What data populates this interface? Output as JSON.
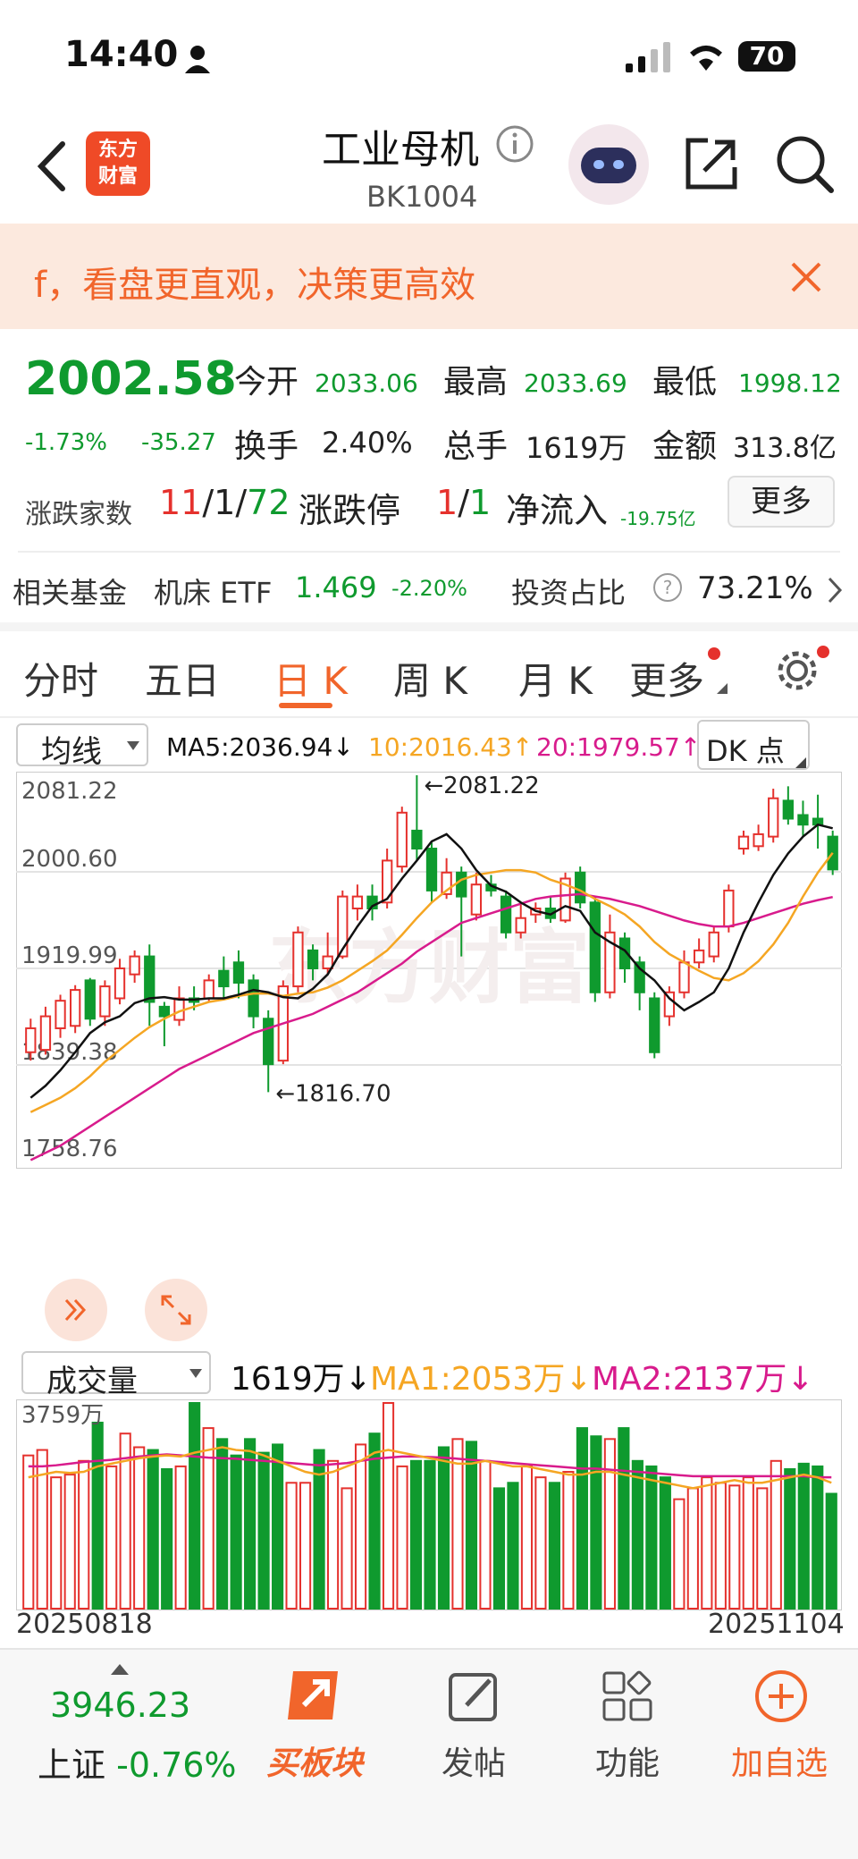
{
  "status_bar": {
    "time": "14:40",
    "battery": "70"
  },
  "nav": {
    "logo_line1": "东方",
    "logo_line2": "财富",
    "title": "工业母机",
    "code": "BK1004"
  },
  "banner": {
    "text": "f，看盘更直观，决策更高效"
  },
  "quote": {
    "price": "2002.58",
    "change_pct": "-1.73%",
    "change_amt": "-35.27",
    "open_label": "今开",
    "open": "2033.06",
    "high_label": "最高",
    "high": "2033.69",
    "low_label": "最低",
    "low": "1998.12",
    "turnover_label": "换手",
    "turnover": "2.40%",
    "volume_label": "总手",
    "volume": "1619万",
    "amount_label": "金额",
    "amount": "313.8亿",
    "adv_label": "涨跌家数",
    "adv_up": "11",
    "adv_flat": "1",
    "adv_down": "72",
    "limit_label": "涨跌停",
    "limit_up": "1",
    "limit_down": "1",
    "netflow_label": "净流入",
    "netflow": "-19.75亿",
    "more_button": "更多"
  },
  "fund": {
    "label": "相关基金",
    "name": "机床 ETF",
    "price": "1.469",
    "pct": "-2.20%",
    "ratio_label": "投资占比",
    "ratio": "73.21%"
  },
  "tabs": {
    "items": [
      "分时",
      "五日",
      "日 K",
      "周 K",
      "月 K",
      "更多"
    ],
    "active": "日 K"
  },
  "kline": {
    "indicator_select": "均线",
    "ma5": "MA5:2036.94↓",
    "ma10": "10:2016.43↑",
    "ma20": "20:1979.57↑",
    "dk_button": "DK 点",
    "y_labels": [
      "2081.22",
      "2000.60",
      "1919.99",
      "1839.38",
      "1758.76"
    ],
    "max_note": "←2081.22",
    "min_note": "←1816.70",
    "watermark": "东方财富",
    "colors": {
      "up": "#e5312d",
      "down": "#0f9a2e",
      "ma5": "#111111",
      "ma10": "#f5a623",
      "ma20": "#d81b8c"
    }
  },
  "volume": {
    "indicator_select": "成交量",
    "value": "1619万↓",
    "ma1": "MA1:2053万↓",
    "ma2": "MA2:2137万↓",
    "top_label": "3759万",
    "date_start": "20250818",
    "date_end": "20251104"
  },
  "bottom": {
    "index_value": "3946.23",
    "index_name": "上证",
    "index_pct": "-0.76%",
    "buy": "买板块",
    "post": "发帖",
    "func": "功能",
    "add": "加自选"
  },
  "chart_data": {
    "type": "candlestick",
    "x": [
      "20250818",
      "20251104"
    ],
    "ylim": [
      1758.76,
      2081.22
    ],
    "candles": [
      [
        1850,
        1870,
        1878,
        1843
      ],
      [
        1852,
        1880,
        1888,
        1848
      ],
      [
        1870,
        1893,
        1898,
        1862
      ],
      [
        1872,
        1902,
        1906,
        1866
      ],
      [
        1910,
        1878,
        1912,
        1872
      ],
      [
        1880,
        1905,
        1910,
        1872
      ],
      [
        1895,
        1920,
        1928,
        1890
      ],
      [
        1915,
        1930,
        1935,
        1908
      ],
      [
        1930,
        1892,
        1940,
        1872
      ],
      [
        1888,
        1880,
        1892,
        1855
      ],
      [
        1877,
        1895,
        1905,
        1872
      ],
      [
        1895,
        1892,
        1905,
        1885
      ],
      [
        1895,
        1910,
        1915,
        1892
      ],
      [
        1918,
        1905,
        1930,
        1895
      ],
      [
        1925,
        1908,
        1935,
        1895
      ],
      [
        1910,
        1880,
        1915,
        1870
      ],
      [
        1878,
        1840,
        1885,
        1816.7
      ],
      [
        1843,
        1905,
        1910,
        1840
      ],
      [
        1905,
        1950,
        1955,
        1900
      ],
      [
        1935,
        1920,
        1940,
        1910
      ],
      [
        1920,
        1930,
        1950,
        1915
      ],
      [
        1930,
        1980,
        1985,
        1928
      ],
      [
        1970,
        1980,
        1990,
        1960
      ],
      [
        1980,
        1970,
        1990,
        1960
      ],
      [
        1975,
        2010,
        2020,
        1970
      ],
      [
        2005,
        2050,
        2055,
        2000
      ],
      [
        2035,
        2020,
        2081.22,
        2010
      ],
      [
        2020,
        1985,
        2025,
        1975
      ],
      [
        1982,
        2000,
        2012,
        1978
      ],
      [
        2000,
        1980,
        2005,
        1930
      ],
      [
        1965,
        1990,
        2000,
        1960
      ],
      [
        1990,
        1985,
        1998,
        1980
      ],
      [
        1980,
        1950,
        1985,
        1945
      ],
      [
        1950,
        1962,
        1975,
        1945
      ],
      [
        1965,
        1970,
        1975,
        1958
      ],
      [
        1970,
        1962,
        1980,
        1958
      ],
      [
        1960,
        1995,
        2000,
        1958
      ],
      [
        2000,
        1975,
        2005,
        1970
      ],
      [
        1975,
        1900,
        1980,
        1892
      ],
      [
        1900,
        1950,
        1965,
        1895
      ],
      [
        1945,
        1920,
        1950,
        1908
      ],
      [
        1925,
        1900,
        1930,
        1885
      ],
      [
        1895,
        1850,
        1900,
        1845
      ],
      [
        1880,
        1900,
        1905,
        1872
      ],
      [
        1900,
        1925,
        1935,
        1895
      ],
      [
        1925,
        1935,
        1945,
        1920
      ],
      [
        1930,
        1950,
        1955,
        1925
      ],
      [
        1955,
        1985,
        1990,
        1950
      ],
      [
        2020,
        2030,
        2035,
        2015
      ],
      [
        2022,
        2032,
        2040,
        2018
      ],
      [
        2030,
        2062,
        2070,
        2025
      ],
      [
        2060,
        2045,
        2072,
        2040
      ],
      [
        2048,
        2040,
        2060,
        2030
      ],
      [
        2045,
        2040,
        2065,
        2020
      ],
      [
        2030,
        2002.58,
        2035,
        1998
      ]
    ],
    "ma5": [
      1812,
      1822,
      1835,
      1850,
      1866,
      1875,
      1880,
      1891,
      1895,
      1896,
      1894,
      1894,
      1895,
      1895,
      1898,
      1902,
      1900,
      1896,
      1895,
      1903,
      1915,
      1936,
      1955,
      1972,
      1978,
      1995,
      2010,
      2026,
      2032,
      2020,
      2002,
      1989,
      1984,
      1975,
      1968,
      1965,
      1972,
      1968,
      1950,
      1942,
      1935,
      1920,
      1910,
      1895,
      1885,
      1892,
      1900,
      1920,
      1950,
      1975,
      1998,
      2016,
      2030,
      2040,
      2036.94
    ],
    "ma10": [
      1800,
      1806,
      1812,
      1820,
      1830,
      1842,
      1852,
      1862,
      1871,
      1878,
      1884,
      1888,
      1892,
      1894,
      1897,
      1899,
      1899,
      1897,
      1899,
      1900,
      1904,
      1910,
      1918,
      1926,
      1935,
      1948,
      1962,
      1975,
      1985,
      1994,
      1998,
      2000,
      2002,
      2002,
      2000,
      1994,
      1990,
      1985,
      1978,
      1972,
      1965,
      1955,
      1942,
      1932,
      1925,
      1918,
      1912,
      1910,
      1916,
      1926,
      1940,
      1958,
      1980,
      2000,
      2016.43
    ],
    "ma20": [
      1760,
      1766,
      1772,
      1780,
      1788,
      1796,
      1804,
      1812,
      1820,
      1828,
      1836,
      1842,
      1848,
      1854,
      1860,
      1866,
      1870,
      1874,
      1878,
      1882,
      1888,
      1894,
      1900,
      1908,
      1916,
      1924,
      1934,
      1942,
      1950,
      1958,
      1962,
      1966,
      1970,
      1974,
      1978,
      1980,
      1981,
      1982,
      1980,
      1978,
      1975,
      1972,
      1968,
      1964,
      1960,
      1957,
      1955,
      1955,
      1958,
      1962,
      1966,
      1970,
      1974,
      1977,
      1979.57
    ],
    "volume": {
      "ylim": [
        0,
        3759
      ],
      "values": [
        2800,
        2900,
        2400,
        2450,
        2700,
        3400,
        2600,
        3200,
        2950,
        2900,
        2550,
        2600,
        3759,
        3300,
        3100,
        2800,
        3100,
        2850,
        3000,
        2300,
        2300,
        2900,
        2700,
        2200,
        3000,
        3200,
        3759,
        2600,
        2700,
        2700,
        2950,
        3100,
        3050,
        2700,
        2200,
        2300,
        2600,
        2400,
        2300,
        2500,
        3300,
        3150,
        3100,
        3300,
        2700,
        2600,
        2400,
        2000,
        2200,
        2400,
        2300,
        2250,
        2400,
        2200,
        2700,
        2550,
        2650,
        2600,
        2100
      ]
    },
    "vol_ma1": [
      2400,
      2450,
      2500,
      2480,
      2500,
      2600,
      2650,
      2700,
      2750,
      2780,
      2800,
      2780,
      2850,
      2900,
      2950,
      2900,
      2880,
      2800,
      2700,
      2600,
      2500,
      2450,
      2500,
      2600,
      2700,
      2850,
      2900,
      2850,
      2800,
      2750,
      2700,
      2650,
      2650,
      2700,
      2650,
      2600,
      2600,
      2550,
      2500,
      2450,
      2450,
      2500,
      2500,
      2450,
      2400,
      2350,
      2300,
      2250,
      2200,
      2250,
      2300,
      2350,
      2300,
      2300,
      2350,
      2400,
      2450,
      2400,
      2300
    ],
    "vol_ma2": [
      2600,
      2600,
      2620,
      2650,
      2680,
      2700,
      2720,
      2750,
      2780,
      2800,
      2820,
      2800,
      2780,
      2760,
      2750,
      2740,
      2720,
      2700,
      2680,
      2660,
      2640,
      2620,
      2640,
      2660,
      2700,
      2740,
      2760,
      2780,
      2780,
      2770,
      2760,
      2740,
      2720,
      2700,
      2680,
      2660,
      2640,
      2620,
      2600,
      2580,
      2560,
      2560,
      2540,
      2520,
      2500,
      2480,
      2460,
      2440,
      2420,
      2420,
      2420,
      2420,
      2420,
      2420,
      2420,
      2420,
      2420,
      2400,
      2400
    ]
  }
}
